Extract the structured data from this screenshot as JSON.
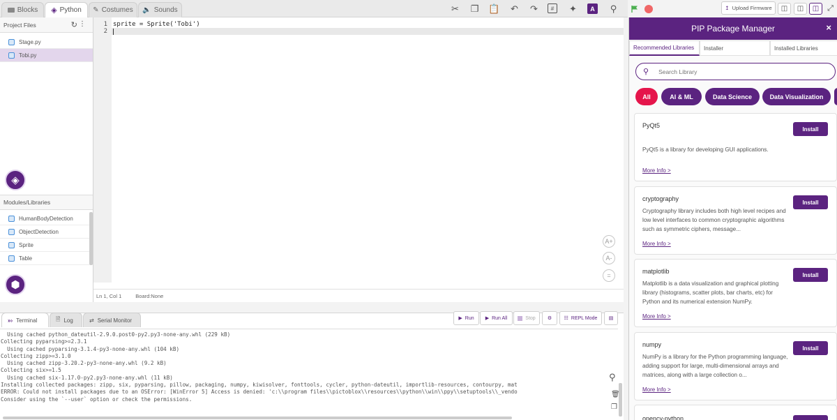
{
  "tabs": [
    "Blocks",
    "Python",
    "Costumes",
    "Sounds"
  ],
  "toolbar": {
    "upload_firmware": "Upload Firmware"
  },
  "project_files": {
    "title": "Project Files",
    "files": [
      "Stage.py",
      "Tobi.py"
    ]
  },
  "modules": {
    "title": "Modules/Libraries",
    "items": [
      "HumanBodyDetection",
      "ObjectDetection",
      "Sprite",
      "Table"
    ]
  },
  "editor": {
    "lines": [
      "sprite = Sprite('Tobi')",
      ""
    ],
    "line_numbers": [
      "1",
      "2"
    ],
    "status_position": "Ln 1, Col 1",
    "status_board": "Board:None"
  },
  "bottom": {
    "tabs": [
      "Terminal",
      "Log",
      "Serial Monitor"
    ],
    "buttons": {
      "run": "Run",
      "run_all": "Run All",
      "stop": "Stop",
      "repl": "REPL Mode"
    },
    "terminal_lines": [
      "  Using cached python_dateutil-2.9.0.post0-py2.py3-none-any.whl (229 kB)",
      "Collecting pyparsing>=2.3.1",
      "  Using cached pyparsing-3.1.4-py3-none-any.whl (104 kB)",
      "Collecting zipp>=3.1.0",
      "  Using cached zipp-3.20.2-py3-none-any.whl (9.2 kB)",
      "Collecting six>=1.5",
      "  Using cached six-1.17.0-py2.py3-none-any.whl (11 kB)",
      "Installing collected packages: zipp, six, pyparsing, pillow, packaging, numpy, kiwisolver, fonttools, cycler, python-dateutil, importlib-resources, contourpy, mat",
      "ERROR: Could not install packages due to an OSError: [WinError 5] Access is denied: 'c:\\\\program files\\\\pictoblox\\\\resources\\\\python\\\\win\\\\ppy\\\\setuptools\\\\_vendo",
      "Consider using the `--user` option or check the permissions."
    ]
  },
  "pip": {
    "title": "PIP Package Manager",
    "tabs": [
      "Recommended Libraries",
      "Installer",
      "Installed Libraries"
    ],
    "search_placeholder": "Search Library",
    "filters": [
      "All",
      "AI & ML",
      "Data Science",
      "Data Visualization"
    ],
    "install_label": "Install",
    "more_info": "More Info >",
    "packages": [
      {
        "name": "PyQt5",
        "desc": "PyQt5 is a library for developing GUI applications."
      },
      {
        "name": "cryptography",
        "desc": "Cryptography library includes both high level recipes and low level interfaces to common cryptographic algorithms such as symmetric ciphers, message..."
      },
      {
        "name": "matplotlib",
        "desc": "Matplotlib is a data visualization and graphical plotting library (histograms, scatter plots, bar charts, etc) for Python and its numerical extension NumPy."
      },
      {
        "name": "numpy",
        "desc": "NumPy is a library for the Python programming language, adding support for large, multi-dimensional arrays and matrices, along with a large collection o..."
      },
      {
        "name": "opencv-python",
        "desc": ""
      }
    ]
  },
  "colors": {
    "accent": "#5b2380",
    "active_filter": "#e5154b",
    "run_flag": "#4caf50",
    "stop": "#f06767"
  }
}
